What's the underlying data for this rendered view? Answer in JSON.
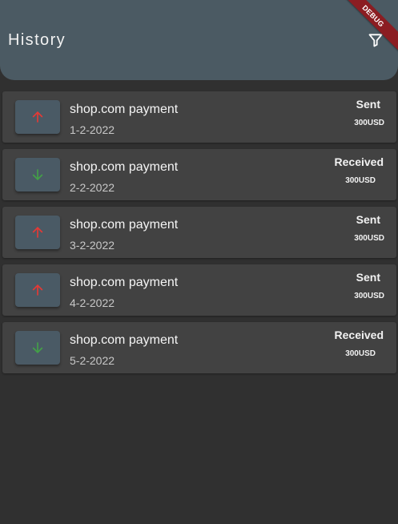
{
  "appbar": {
    "title": "History",
    "filter_icon": "filter-icon",
    "debug_banner": "DEBUG",
    "color": "#4b5a63"
  },
  "colors": {
    "background": "#303030",
    "card": "#424242",
    "sent_arrow": "#e53935",
    "received_arrow": "#43a047"
  },
  "transactions": [
    {
      "title": "shop.com payment",
      "date": "1-2-2022",
      "status": "Sent",
      "amount": "300USD",
      "direction": "sent",
      "icon": "arrow-up-icon"
    },
    {
      "title": "shop.com payment",
      "date": "2-2-2022",
      "status": "Received",
      "amount": "300USD",
      "direction": "received",
      "icon": "arrow-down-icon"
    },
    {
      "title": "shop.com payment",
      "date": "3-2-2022",
      "status": "Sent",
      "amount": "300USD",
      "direction": "sent",
      "icon": "arrow-up-icon"
    },
    {
      "title": "shop.com payment",
      "date": "4-2-2022",
      "status": "Sent",
      "amount": "300USD",
      "direction": "sent",
      "icon": "arrow-up-icon"
    },
    {
      "title": "shop.com payment",
      "date": "5-2-2022",
      "status": "Received",
      "amount": "300USD",
      "direction": "received",
      "icon": "arrow-down-icon"
    }
  ]
}
